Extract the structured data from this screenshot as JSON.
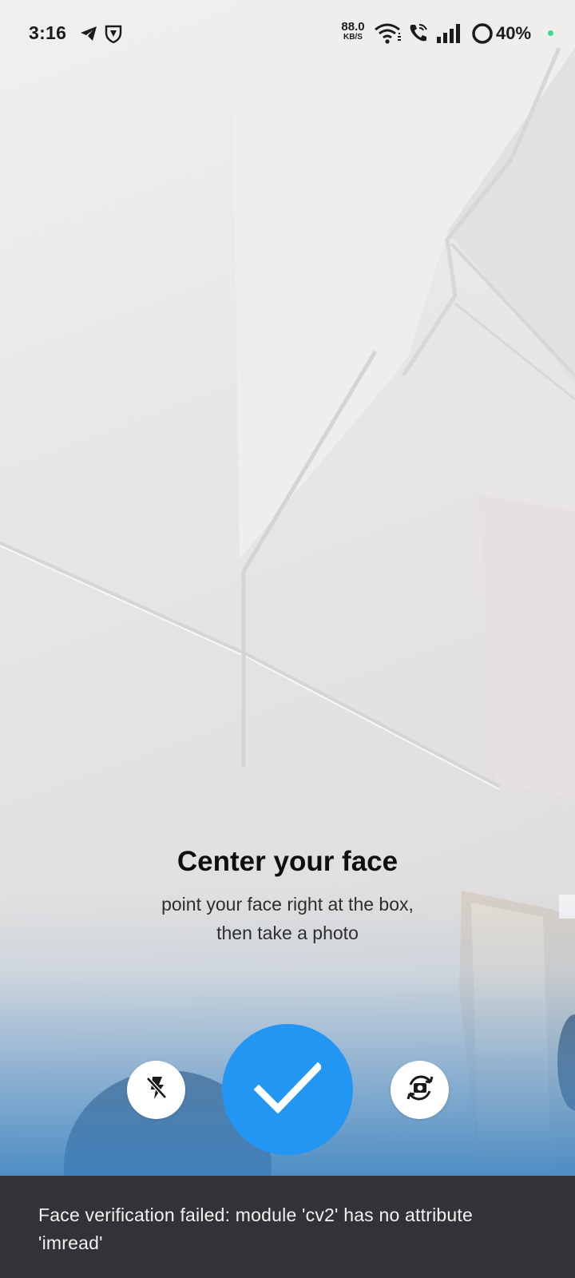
{
  "status_bar": {
    "time": "3:16",
    "net_speed_value": "88.0",
    "net_speed_unit": "KB/S",
    "battery_percent": "40%",
    "icons": [
      "telegram-icon",
      "vpn-shield-icon",
      "wifi-icon",
      "wifi-calling-icon",
      "signal-icon",
      "battery-ring-icon"
    ]
  },
  "instructions": {
    "title": "Center your face",
    "subtitle_line1": "point your face right at the box,",
    "subtitle_line2": "then take a photo"
  },
  "controls": {
    "flash_icon": "flash-off-icon",
    "capture_icon": "check-icon",
    "switch_icon": "camera-switch-icon",
    "capture_color": "#2196f3"
  },
  "snackbar": {
    "message": "Face verification failed: module 'cv2' has no attribute 'imread'"
  },
  "colors": {
    "accent": "#2196f3",
    "snackbar_bg": "#323237",
    "charge_dot": "#3ddc84"
  }
}
